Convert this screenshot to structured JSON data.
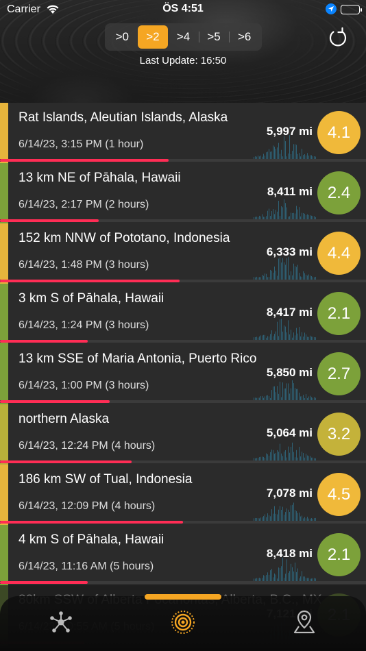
{
  "status_bar": {
    "carrier": "Carrier",
    "time": "ÖS 4:51"
  },
  "filter": {
    "options": [
      ">0",
      ">2",
      ">4",
      ">5",
      ">6"
    ],
    "selected_index": 1
  },
  "last_update": "Last Update: 16:50",
  "colors": {
    "accent": "#f5a623",
    "progress": "#ff2d55",
    "mag_yellow": "#f0b93a",
    "mag_green": "#7ca13a",
    "mag_olive": "#c4b23a"
  },
  "quakes": [
    {
      "place": "Rat Islands, Aleutian Islands, Alaska",
      "time": "6/14/23, 3:15 PM (1 hour)",
      "distance": "5,997 mi",
      "magnitude": "4.1",
      "color": "#f0b93a",
      "strip": "#e6b43c",
      "progress": 0.46
    },
    {
      "place": "13 km NE of Pāhala, Hawaii",
      "time": "6/14/23, 2:17 PM (2 hours)",
      "distance": "8,411 mi",
      "magnitude": "2.4",
      "color": "#7ca13a",
      "strip": "#7ca13a",
      "progress": 0.27
    },
    {
      "place": "152 km NNW of Pototano, Indonesia",
      "time": "6/14/23, 1:48 PM (3 hours)",
      "distance": "6,333 mi",
      "magnitude": "4.4",
      "color": "#f0b93a",
      "strip": "#e6b43c",
      "progress": 0.49
    },
    {
      "place": "3 km S of Pāhala, Hawaii",
      "time": "6/14/23, 1:24 PM (3 hours)",
      "distance": "8,417 mi",
      "magnitude": "2.1",
      "color": "#7ca13a",
      "strip": "#7ca13a",
      "progress": 0.24
    },
    {
      "place": "13 km SSE of Maria Antonia, Puerto Rico",
      "time": "6/14/23, 1:00 PM (3 hours)",
      "distance": "5,850 mi",
      "magnitude": "2.7",
      "color": "#7ca13a",
      "strip": "#7ca13a",
      "progress": 0.3
    },
    {
      "place": "northern Alaska",
      "time": "6/14/23, 12:24 PM (4 hours)",
      "distance": "5,064 mi",
      "magnitude": "3.2",
      "color": "#c4b23a",
      "strip": "#b8b03a",
      "progress": 0.36
    },
    {
      "place": "186 km SW of Tual, Indonesia",
      "time": "6/14/23, 12:09 PM (4 hours)",
      "distance": "7,078 mi",
      "magnitude": "4.5",
      "color": "#f0b93a",
      "strip": "#e6b43c",
      "progress": 0.5
    },
    {
      "place": "4 km S of Pāhala, Hawaii",
      "time": "6/14/23, 11:16 AM (5 hours)",
      "distance": "8,418 mi",
      "magnitude": "2.1",
      "color": "#7ca13a",
      "strip": "#7ca13a",
      "progress": 0.24
    },
    {
      "place": "80km SSW of Alberta Pocahontas, Alberta, B.C., MX",
      "time": "6/14/23, 10:55 AM (5 hours)",
      "distance": "7,121 mi",
      "magnitude": "2.1",
      "color": "#7ca13a",
      "strip": "#7ca13a",
      "progress": 0.23
    }
  ],
  "tabs": [
    {
      "icon": "network-icon"
    },
    {
      "icon": "seismic-rings-icon"
    },
    {
      "icon": "map-pin-icon"
    }
  ]
}
